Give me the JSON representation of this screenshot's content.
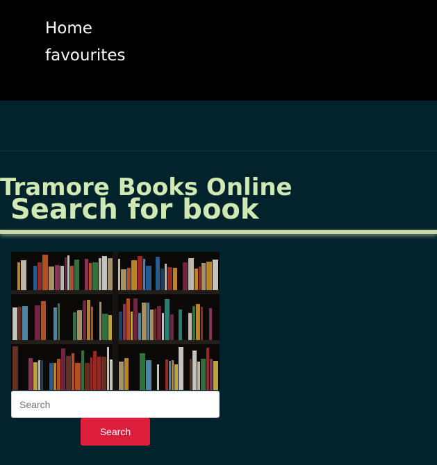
{
  "nav": {
    "home_label": "Home",
    "favourites_label": "favourites"
  },
  "site": {
    "title": "Tramore Books Online"
  },
  "page": {
    "heading": "Search for book"
  },
  "image": {
    "alt": "bookshelf"
  },
  "search": {
    "placeholder": "Search",
    "value": "",
    "button_label": "Search"
  },
  "colors": {
    "nav_background": "#000000",
    "page_background": "#03232c",
    "heading_text": "#cfe8b4",
    "divider": "#c6d7a8",
    "button": "#dc1e3c"
  }
}
